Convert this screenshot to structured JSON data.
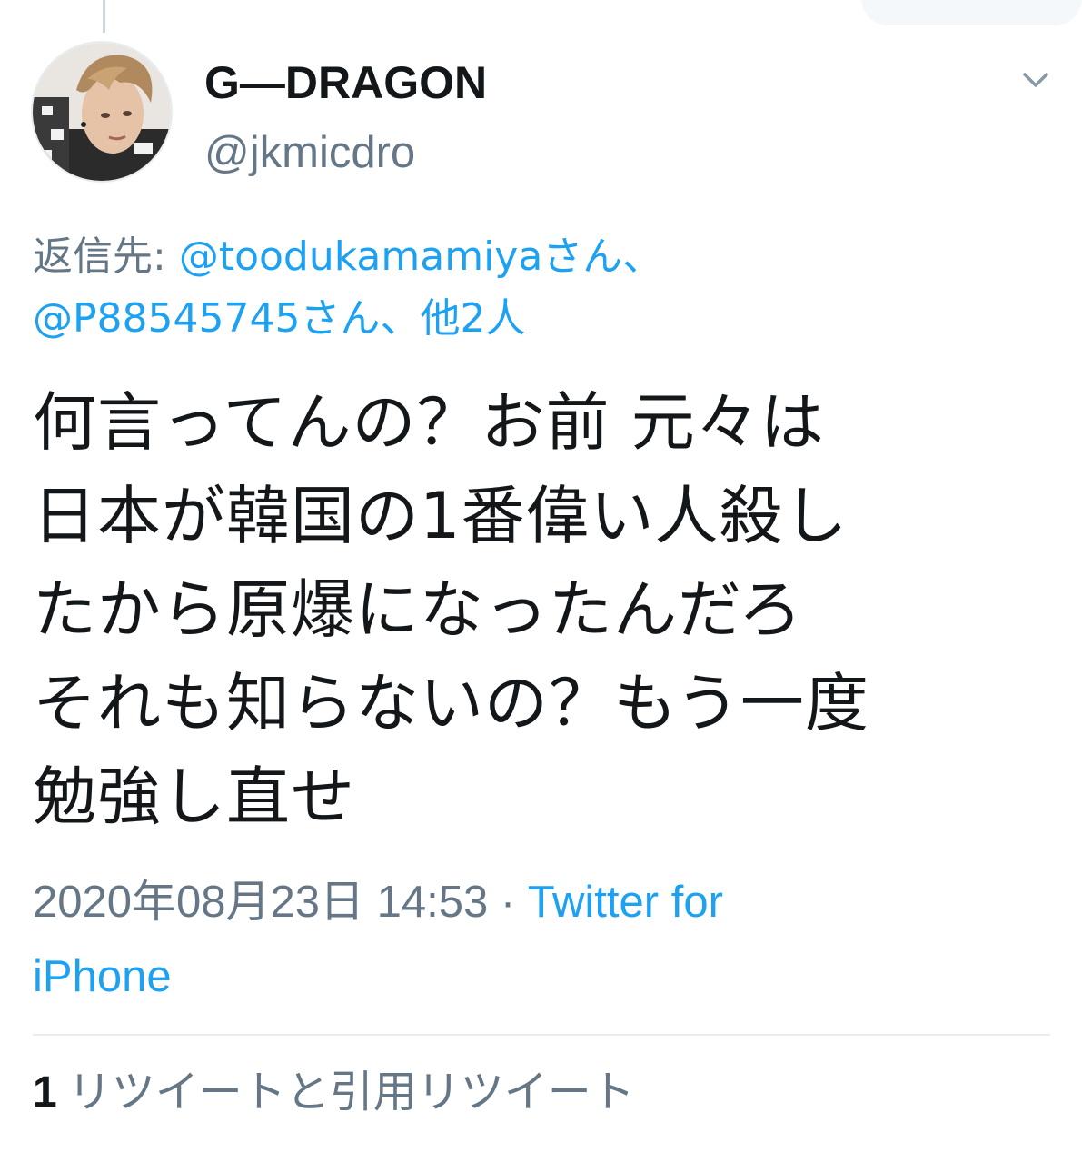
{
  "author": {
    "name": "G—DRAGON",
    "handle": "@jkmicdro",
    "avatar_icon": "user-avatar-photo"
  },
  "reply": {
    "prefix": "返信先: ",
    "line1_link": "@toodukamamiyaさん、",
    "line2_link": "@P88545745さん、他2人"
  },
  "tweet": {
    "lines": [
      "何言ってんの？お前 元々は",
      "日本が韓国の1番偉い人殺し",
      "たから原爆になったんだろ",
      "それも知らないの？もう一度",
      "勉強し直せ"
    ]
  },
  "meta": {
    "timestamp": "2020年08月23日 14:53 · ",
    "source_part1": "Twitter for",
    "source_part2": "iPhone"
  },
  "stats": {
    "retweet_count": "1",
    "retweet_label": "リツイートと引用リツイート"
  },
  "colors": {
    "link": "#1da1f2",
    "secondary_text": "#657786",
    "primary_text": "#14171a",
    "divider": "#e6ecf0"
  }
}
